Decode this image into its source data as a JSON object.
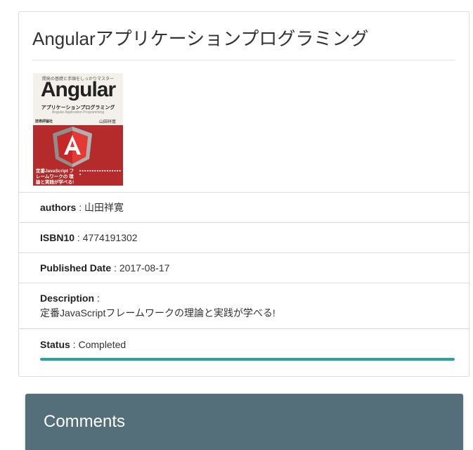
{
  "book": {
    "title": "Angularアプリケーションプログラミング",
    "cover": {
      "kicker": "開発の基礎と手順をしっかりマスター",
      "word": "Angular",
      "subtitle": "アプリケーションプログラミング",
      "subtitle_en": "Angular Application Programming",
      "author": "山田祥寛",
      "publisher": "技術評論社",
      "tagline": "定番JavaScript フレームワークの 理論と実践が学べる!"
    },
    "fields": {
      "authors_label": "authors",
      "authors_value": "山田祥寛",
      "isbn_label": "ISBN10",
      "isbn_value": "4774191302",
      "date_label": "Published Date",
      "date_value": "2017-08-17",
      "description_label": "Description",
      "description_value": "定番JavaScriptフレームワークの理論と実践が学べる!",
      "status_label": "Status",
      "status_value": "Completed"
    },
    "separator": " : ",
    "progress_percent": 100,
    "colors": {
      "progress": "#26a69a",
      "comments_header": "#546e7a"
    }
  },
  "comments": {
    "title": "Comments"
  }
}
